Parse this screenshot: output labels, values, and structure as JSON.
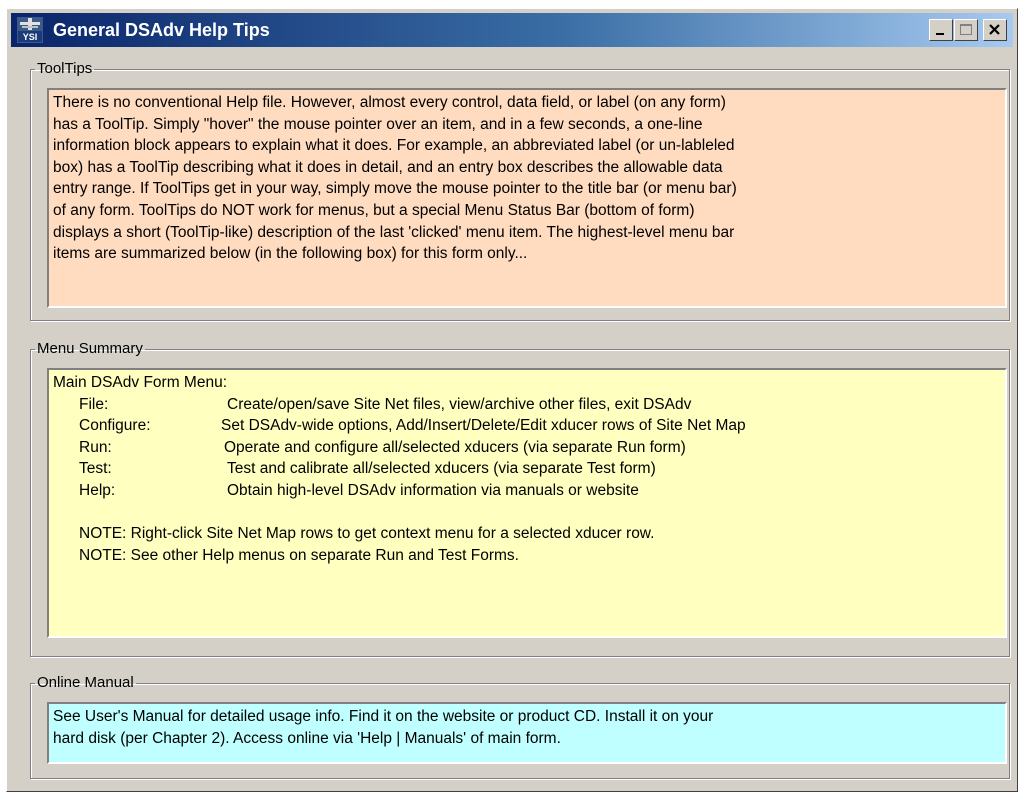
{
  "window": {
    "title": "General DSAdv Help Tips",
    "icon": "ysi-app-icon",
    "controls": {
      "minimize": "minimize-icon",
      "maximize": "maximize-icon",
      "close": "close-icon"
    }
  },
  "tooltips": {
    "legend": "ToolTips",
    "lines": [
      "There is no conventional Help file.  However, almost every control, data field, or label (on any form)",
      "has a ToolTip.  Simply \"hover\" the mouse pointer over an item, and in a few seconds, a one-line",
      "information block appears to explain what it does.  For example, an abbreviated label (or un-lableled",
      "box) has a ToolTip describing what it does in detail, and an entry box describes the allowable data",
      "entry range.  If ToolTips get in your way, simply move the mouse pointer to the title bar (or menu bar)",
      "of any form. ToolTips do NOT work for menus, but a special Menu Status Bar (bottom of form)",
      "displays a short (ToolTip-like) description of the last 'clicked' menu item.  The highest-level menu bar",
      "items are summarized below (in the following box) for this form only..."
    ]
  },
  "menu_summary": {
    "legend": "Menu Summary",
    "heading": "Main DSAdv Form Menu:",
    "items": [
      {
        "key": "File:",
        "desc": "Create/open/save Site Net files, view/archive other files, exit DSAdv"
      },
      {
        "key": "Configure:",
        "desc": "Set DSAdv-wide options, Add/Insert/Delete/Edit xducer rows of Site Net Map"
      },
      {
        "key": "Run:",
        "desc": "Operate and configure all/selected xducers (via separate Run form)"
      },
      {
        "key": "Test:",
        "desc": "Test and calibrate all/selected xducers (via separate Test form)"
      },
      {
        "key": "Help:",
        "desc": "Obtain high-level DSAdv information via manuals or website"
      }
    ],
    "notes": [
      "NOTE: Right-click Site Net Map rows to get context menu for a selected xducer row.",
      "NOTE: See other Help menus on separate Run and Test Forms."
    ]
  },
  "online_manual": {
    "legend": "Online Manual",
    "lines": [
      "See User's Manual for detailed usage info.  Find it on the website or product CD.  Install it on your",
      "hard disk (per Chapter 2).  Access online via 'Help | Manuals' of main form."
    ]
  },
  "colors": {
    "tooltips_bg": "#ffdcc0",
    "menu_bg": "#ffffc0",
    "manual_bg": "#c0ffff",
    "window_bg": "#d4d0c8",
    "title_start": "#0a246a",
    "title_end": "#a6caf0"
  }
}
